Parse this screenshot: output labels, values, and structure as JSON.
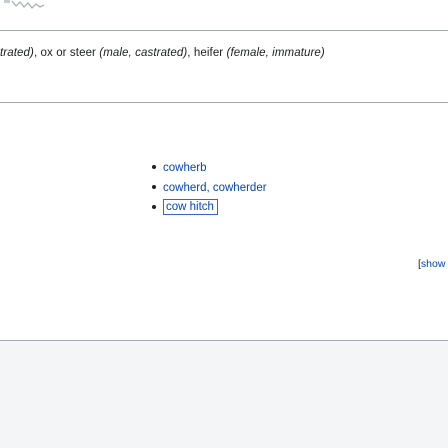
{
  "gloss": {
    "lead_fragment": "trated)",
    "item1": "ox",
    "or": "or",
    "item2": "steer",
    "item2_qual": "(male, castrated)",
    "item3": "heifer",
    "item3_qual": "(female, immature)"
  },
  "related_terms": [
    {
      "label": "cowherb"
    },
    {
      "label": "cowherd, cowherder"
    },
    {
      "label": "cow hitch"
    }
  ],
  "toggle": {
    "open_bracket": "[",
    "label": "show"
  },
  "colors": {
    "link": "#0645ad",
    "text": "#202122",
    "separator": "#a2a9b1",
    "footer_bg": "#f3f5f7"
  }
}
